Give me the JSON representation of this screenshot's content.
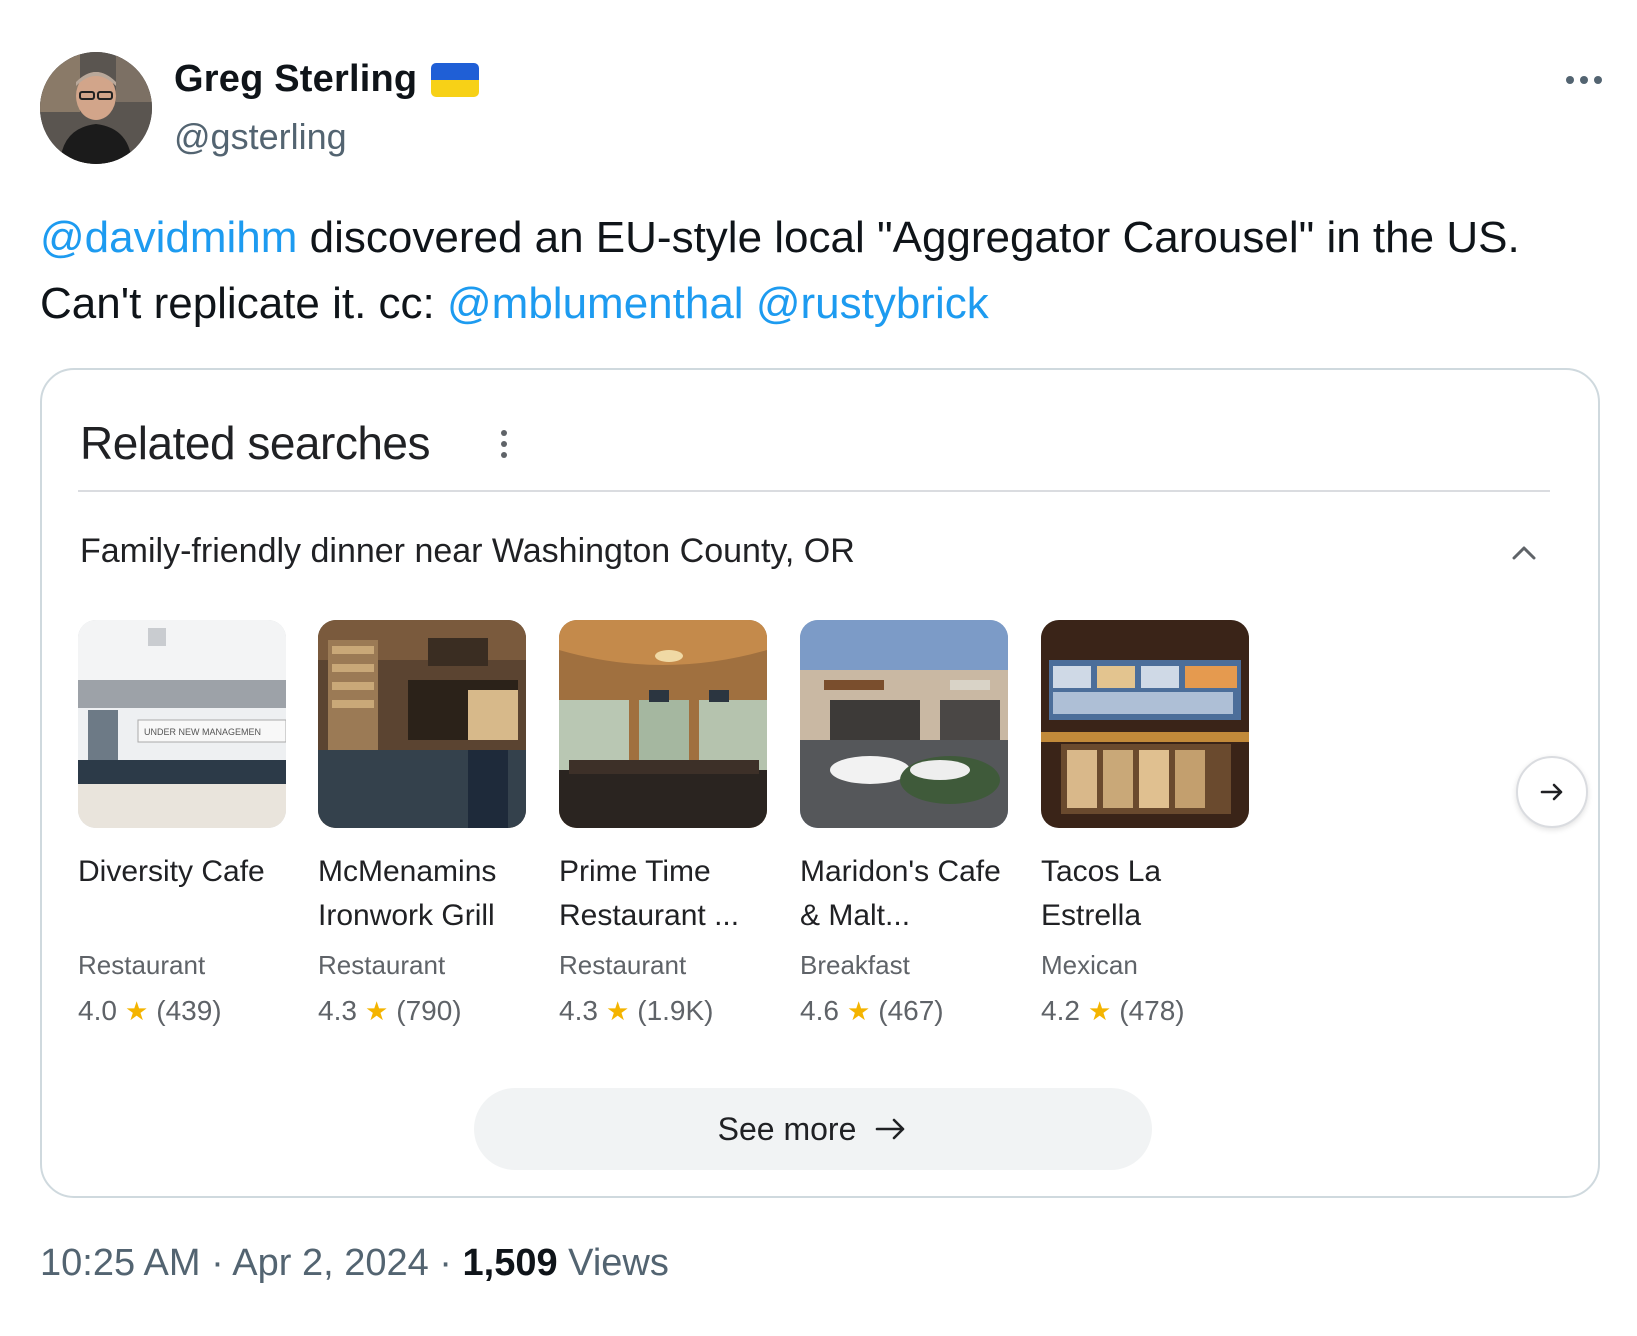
{
  "author": {
    "display_name": "Greg Sterling",
    "handle": "@gsterling",
    "flag_icon": "ukraine-flag-icon",
    "more_icon": "more-horizontal-icon"
  },
  "tweet": {
    "mention_1": "@davidmihm",
    "text_1": " discovered an EU-style local \"Aggregator Carousel\" in the US. Can't replicate it. cc: ",
    "mention_2": "@mblumenthal",
    "text_2": " ",
    "mention_3": "@rustybrick"
  },
  "card": {
    "title": "Related searches",
    "query": "Family-friendly dinner near Washington County, OR",
    "places": [
      {
        "name": "Diversity Cafe",
        "type": "Restaurant",
        "rating": "4.0",
        "reviews": "(439)"
      },
      {
        "name": "McMenamins Ironwork Grill",
        "type": "Restaurant",
        "rating": "4.3",
        "reviews": "(790)"
      },
      {
        "name": "Prime Time Restaurant ...",
        "type": "Restaurant",
        "rating": "4.3",
        "reviews": "(1.9K)"
      },
      {
        "name": "Maridon's Cafe & Malt...",
        "type": "Breakfast",
        "rating": "4.6",
        "reviews": "(467)"
      },
      {
        "name": "Tacos La Estrella",
        "type": "Mexican",
        "rating": "4.2",
        "reviews": "(478)"
      }
    ],
    "thumb_sign_text": "UNDER NEW MANAGEMEN",
    "see_more": "See more"
  },
  "meta": {
    "time": "10:25 AM",
    "sep": " · ",
    "date": "Apr 2, 2024",
    "views_count": "1,509",
    "views_label": " Views"
  },
  "colors": {
    "link": "#1d9bf0",
    "star": "#f4b400",
    "flag_blue": "#1f5fd6",
    "flag_yellow": "#f7d117"
  }
}
